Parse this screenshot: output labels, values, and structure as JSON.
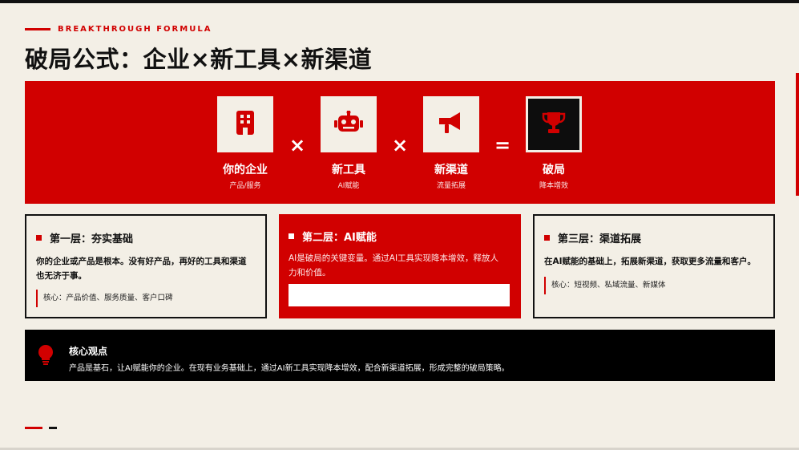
{
  "header": {
    "eyebrow": "BREAKTHROUGH FORMULA",
    "title": "破局公式：企业×新工具×新渠道"
  },
  "formula": {
    "items": [
      {
        "icon": "building-icon",
        "title": "你的企业",
        "subtitle": "产品/服务"
      },
      {
        "icon": "robot-icon",
        "title": "新工具",
        "subtitle": "AI赋能"
      },
      {
        "icon": "megaphone-icon",
        "title": "新渠道",
        "subtitle": "流量拓展"
      },
      {
        "icon": "trophy-icon",
        "title": "破局",
        "subtitle": "降本增效"
      }
    ],
    "operators": [
      "×",
      "×",
      "="
    ]
  },
  "layers": [
    {
      "title": "第一层：夯实基础",
      "body_line1": "你的企业或产品是根本。没有好产品，再好的工具和渠道",
      "body_line2": "也无济于事。",
      "core": "核心：产品价值、服务质量、客户口碑"
    },
    {
      "title": "第二层：AI赋能",
      "body_line1": "AI是破局的关键变量。通过AI工具实现降本增效，释放人",
      "body_line2": "力和价值。"
    },
    {
      "title": "第三层：渠道拓展",
      "body_line1": "在AI赋能的基础上，拓展新渠道，获取更多流量和客户。",
      "core": "核心：短视频、私域流量、新媒体"
    }
  ],
  "insight": {
    "icon": "lightbulb-icon",
    "title": "核心观点",
    "text": "产品是基石，让AI赋能你的企业。在现有业务基础上，通过AI新工具实现降本增效，配合新渠道拓展，形成完整的破局策略。"
  },
  "colors": {
    "accent": "#d10000",
    "background": "#f3efe6",
    "dark": "#000000"
  }
}
